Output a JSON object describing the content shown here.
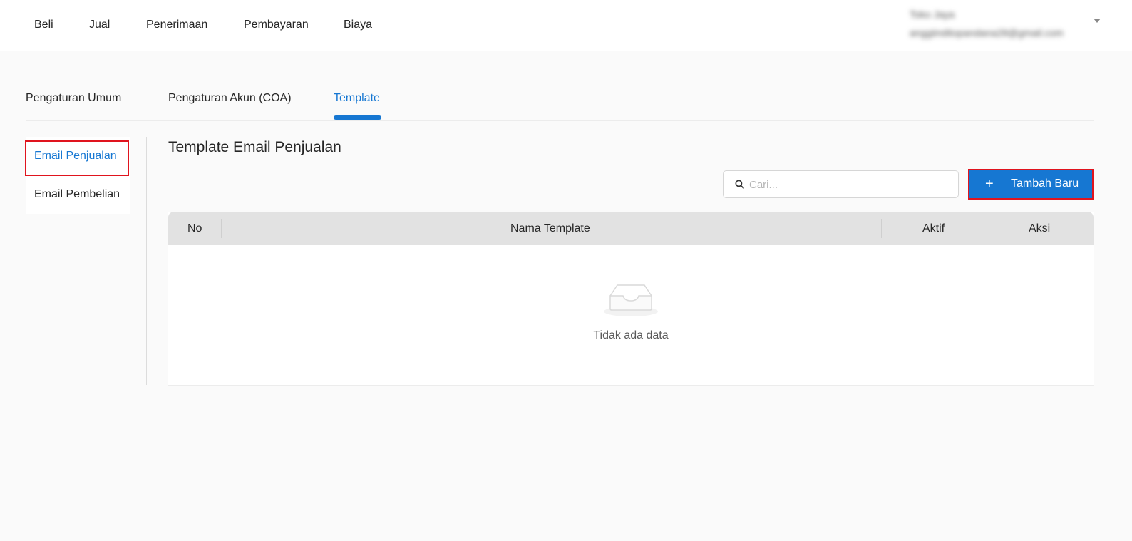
{
  "topnav": {
    "items": [
      "Beli",
      "Jual",
      "Penerimaan",
      "Pembayaran",
      "Biaya"
    ]
  },
  "user": {
    "name": "Toko Jaya",
    "email": "anggiinditopandana28@gmail.com"
  },
  "tabs": [
    {
      "label": "Pengaturan Umum"
    },
    {
      "label": "Pengaturan Akun (COA)"
    },
    {
      "label": "Template"
    }
  ],
  "sidebar": {
    "items": [
      {
        "label": "Email Penjualan"
      },
      {
        "label": "Email Pembelian"
      }
    ]
  },
  "main": {
    "title": "Template Email Penjualan",
    "search_placeholder": "Cari...",
    "add_label": "Tambah Baru",
    "columns": [
      "No",
      "Nama Template",
      "Aktif",
      "Aksi"
    ],
    "empty_text": "Tidak ada data"
  },
  "colors": {
    "accent": "#1677d2",
    "highlight": "#e0141e"
  }
}
